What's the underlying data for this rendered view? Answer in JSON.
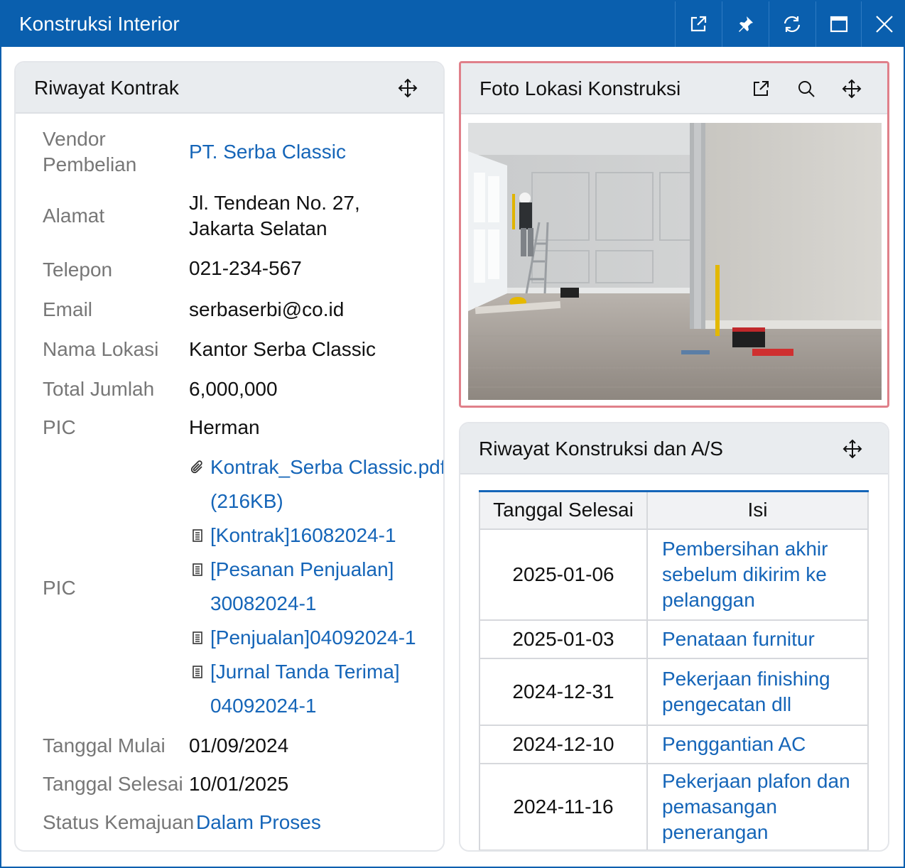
{
  "window": {
    "title": "Konstruksi Interior",
    "buttons": [
      "external-link-icon",
      "pin-icon",
      "refresh-icon",
      "maximize-icon",
      "close-icon"
    ]
  },
  "contract": {
    "title": "Riwayat Kontrak",
    "vendor_label": "Vendor Pembelian",
    "vendor_label_line1": "Vendor",
    "vendor_label_line2": "Pembelian",
    "vendor_value": "PT. Serba Classic",
    "address_label": "Alamat",
    "address_line1": "Jl. Tendean No. 27,",
    "address_line2": "Jakarta Selatan",
    "phone_label": "Telepon",
    "phone_value": "021-234-567",
    "email_label": "Email",
    "email_value": "serbaserbi@co.id",
    "location_label": "Nama Lokasi",
    "location_value": "Kantor Serba Classic",
    "total_label": "Total Jumlah",
    "total_value": "6,000,000",
    "pic_label": "PIC",
    "pic_value": "Herman",
    "docs_label": "PIC",
    "attachments": {
      "file_line1": "Kontrak_Serba Classic.pdf",
      "file_line2": "(216KB)",
      "doc1": "[Kontrak]16082024-1",
      "doc2_line1": "[Pesanan Penjualan]",
      "doc2_line2": "30082024-1",
      "doc3": "[Penjualan]04092024-1",
      "doc4_line1": "[Jurnal Tanda Terima]",
      "doc4_line2": "04092024-1"
    },
    "start_label": "Tanggal Mulai",
    "start_value": "01/09/2024",
    "end_label": "Tanggal Selesai",
    "end_value": "10/01/2025",
    "status_label": "Status Kemajuan",
    "status_value": "Dalam Proses"
  },
  "photo": {
    "title": "Foto Lokasi Konstruksi"
  },
  "history": {
    "title": "Riwayat Konstruksi dan A/S",
    "col_date": "Tanggal Selesai",
    "col_content": "Isi",
    "rows": [
      {
        "date": "2025-01-06",
        "l1": "Pembersihan akhir",
        "l2": "sebelum dikirim ke",
        "l3": "pelanggan"
      },
      {
        "date": "2025-01-03",
        "l1": "Penataan furnitur"
      },
      {
        "date": "2024-12-31",
        "l1": "Pekerjaan finishing",
        "l2": "pengecatan dll"
      },
      {
        "date": "2024-12-10",
        "l1": "Penggantian AC"
      },
      {
        "date": "2024-11-16",
        "l1": "Pekerjaan plafon dan",
        "l2": "pemasangan",
        "l3": "penerangan"
      }
    ]
  }
}
